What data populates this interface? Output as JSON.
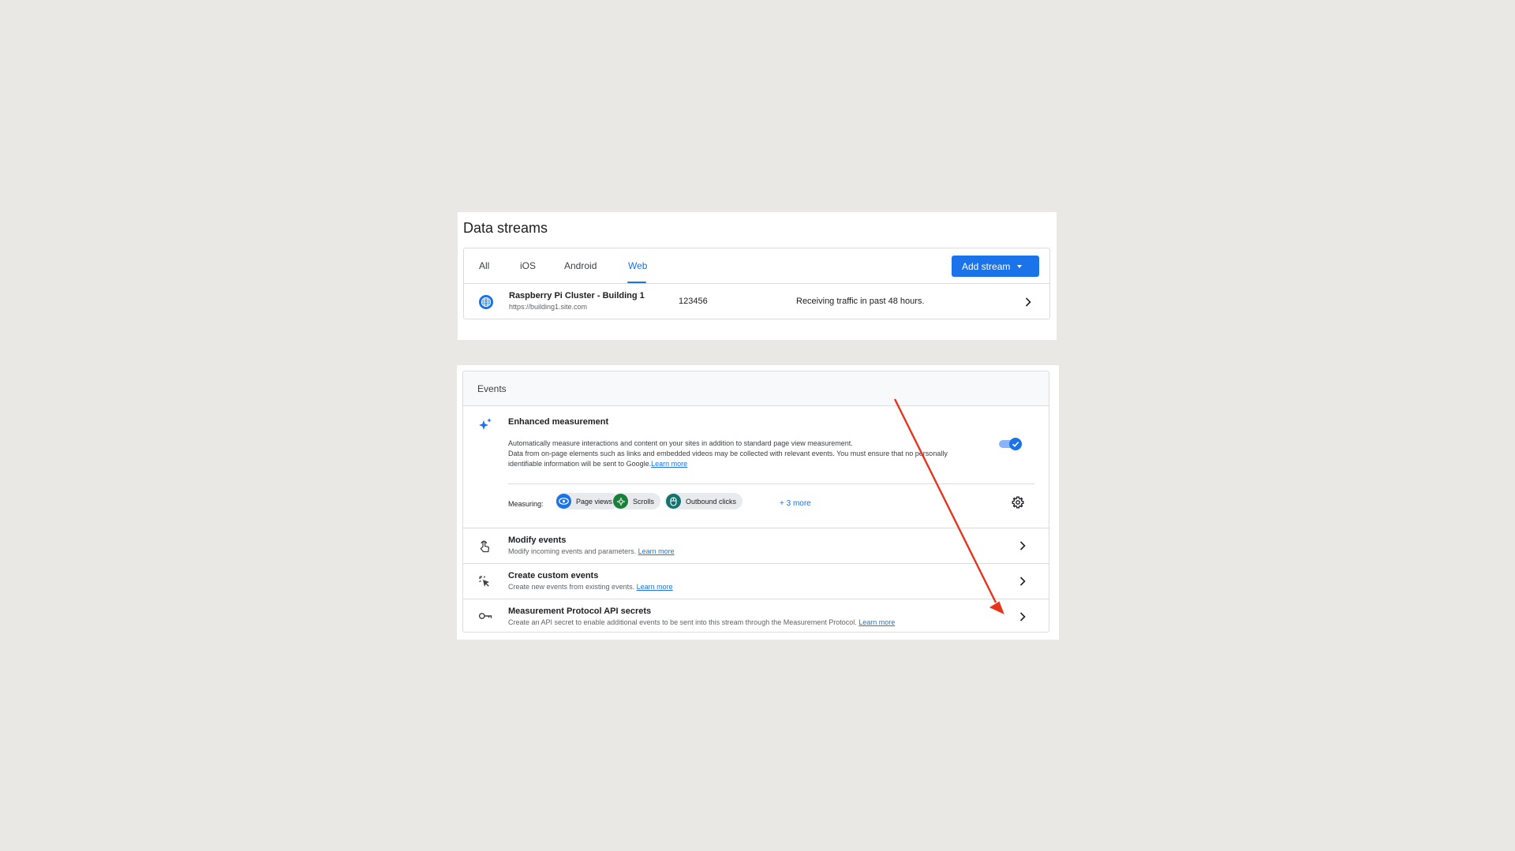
{
  "data_streams": {
    "title": "Data streams",
    "tabs": [
      {
        "label": "All"
      },
      {
        "label": "iOS"
      },
      {
        "label": "Android"
      },
      {
        "label": "Web"
      }
    ],
    "selected_tab": "Web",
    "add_stream_label": "Add stream",
    "stream": {
      "name": "Raspberry Pi Cluster - Building 1",
      "url": "https://building1.site.com",
      "id": "123456",
      "status": "Receiving traffic in past 48 hours."
    }
  },
  "events": {
    "title": "Events",
    "enhanced_measurement": {
      "title": "Enhanced measurement",
      "desc_line1": "Automatically measure interactions and content on your sites in addition to standard page view measurement.",
      "desc_line2": "Data from on-page elements such as links and embedded videos may be collected with relevant events. You must ensure that no personally identifiable information will be sent to Google.",
      "learn_more": "Learn more",
      "enabled": true,
      "measuring_label": "Measuring:",
      "chips": [
        {
          "label": "Page views",
          "icon": "eye-icon",
          "color": "#1a73e8"
        },
        {
          "label": "Scrolls",
          "icon": "scroll-icon",
          "color": "#188038"
        },
        {
          "label": "Outbound clicks",
          "icon": "mouse-icon",
          "color": "#12736f"
        }
      ],
      "more_label": "+ 3 more"
    },
    "rows": [
      {
        "title": "Modify events",
        "desc": "Modify incoming events and parameters.",
        "link": "Learn more",
        "icon": "touch-icon"
      },
      {
        "title": "Create custom events",
        "desc": "Create new events from existing events.",
        "link": "Learn more",
        "icon": "sparkle-click-icon"
      },
      {
        "title": "Measurement Protocol API secrets",
        "desc": "Create an API secret to enable additional events to be sent into this stream through the Measurement Protocol.",
        "link": "Learn more",
        "icon": "key-icon"
      }
    ]
  },
  "colors": {
    "accent": "#1a73e8",
    "annotation_arrow": "#e8341c",
    "background": "#e9e8e5"
  }
}
